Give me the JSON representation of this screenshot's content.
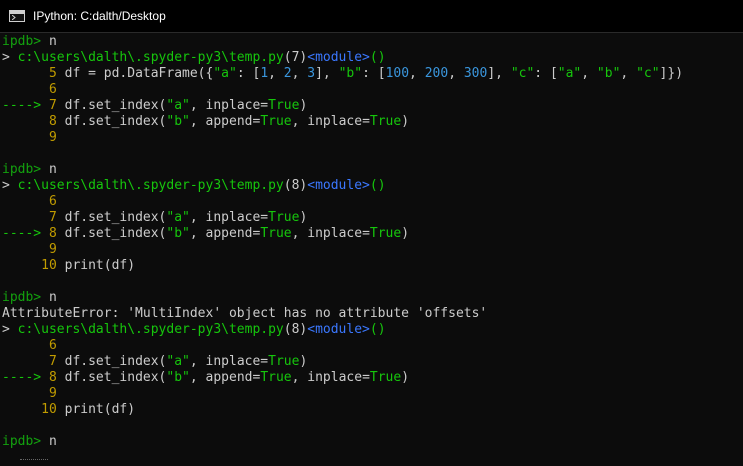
{
  "window": {
    "title": "IPython: C:dalth/Desktop",
    "icon": "console-icon"
  },
  "lines": [
    {
      "segments": [
        {
          "t": "ipdb> ",
          "c": "lp"
        },
        {
          "t": "n",
          "c": "txt"
        }
      ]
    },
    {
      "segments": [
        {
          "t": "> ",
          "c": "txt"
        },
        {
          "t": "c:\\users\\dalth\\.spyder-py3\\temp.py",
          "c": "grn"
        },
        {
          "t": "(7)",
          "c": "txt"
        },
        {
          "t": "<module>",
          "c": "mod"
        },
        {
          "t": "()",
          "c": "grn"
        }
      ]
    },
    {
      "segments": [
        {
          "t": "      ",
          "c": "txt"
        },
        {
          "t": "5",
          "c": "lnum"
        },
        {
          "t": " df = pd.DataFrame({",
          "c": "txt"
        },
        {
          "t": "\"a\"",
          "c": "strc"
        },
        {
          "t": ": [",
          "c": "txt"
        },
        {
          "t": "1",
          "c": "num"
        },
        {
          "t": ", ",
          "c": "txt"
        },
        {
          "t": "2",
          "c": "num"
        },
        {
          "t": ", ",
          "c": "txt"
        },
        {
          "t": "3",
          "c": "num"
        },
        {
          "t": "], ",
          "c": "txt"
        },
        {
          "t": "\"b\"",
          "c": "strc"
        },
        {
          "t": ": [",
          "c": "txt"
        },
        {
          "t": "100",
          "c": "num"
        },
        {
          "t": ", ",
          "c": "txt"
        },
        {
          "t": "200",
          "c": "num"
        },
        {
          "t": ", ",
          "c": "txt"
        },
        {
          "t": "300",
          "c": "num"
        },
        {
          "t": "], ",
          "c": "txt"
        },
        {
          "t": "\"c\"",
          "c": "strc"
        },
        {
          "t": ": [",
          "c": "txt"
        },
        {
          "t": "\"a\"",
          "c": "strc"
        },
        {
          "t": ", ",
          "c": "txt"
        },
        {
          "t": "\"b\"",
          "c": "strc"
        },
        {
          "t": ", ",
          "c": "txt"
        },
        {
          "t": "\"c\"",
          "c": "strc"
        },
        {
          "t": "]})",
          "c": "txt"
        }
      ]
    },
    {
      "segments": [
        {
          "t": "      ",
          "c": "txt"
        },
        {
          "t": "6",
          "c": "lnum"
        }
      ]
    },
    {
      "segments": [
        {
          "t": "----> ",
          "c": "arrow"
        },
        {
          "t": "7",
          "c": "lnum"
        },
        {
          "t": " df.set_index(",
          "c": "txt"
        },
        {
          "t": "\"a\"",
          "c": "strc"
        },
        {
          "t": ", inplace=",
          "c": "txt"
        },
        {
          "t": "True",
          "c": "strc"
        },
        {
          "t": ")",
          "c": "txt"
        }
      ]
    },
    {
      "segments": [
        {
          "t": "      ",
          "c": "txt"
        },
        {
          "t": "8",
          "c": "lnum"
        },
        {
          "t": " df.set_index(",
          "c": "txt"
        },
        {
          "t": "\"b\"",
          "c": "strc"
        },
        {
          "t": ", append=",
          "c": "txt"
        },
        {
          "t": "True",
          "c": "strc"
        },
        {
          "t": ", inplace=",
          "c": "txt"
        },
        {
          "t": "True",
          "c": "strc"
        },
        {
          "t": ")",
          "c": "txt"
        }
      ]
    },
    {
      "segments": [
        {
          "t": "      ",
          "c": "txt"
        },
        {
          "t": "9",
          "c": "lnum"
        }
      ]
    },
    {
      "segments": [
        {
          "t": "",
          "c": "txt"
        }
      ]
    },
    {
      "segments": [
        {
          "t": "ipdb> ",
          "c": "lp"
        },
        {
          "t": "n",
          "c": "txt"
        }
      ]
    },
    {
      "segments": [
        {
          "t": "> ",
          "c": "txt"
        },
        {
          "t": "c:\\users\\dalth\\.spyder-py3\\temp.py",
          "c": "grn"
        },
        {
          "t": "(8)",
          "c": "txt"
        },
        {
          "t": "<module>",
          "c": "mod"
        },
        {
          "t": "()",
          "c": "grn"
        }
      ]
    },
    {
      "segments": [
        {
          "t": "      ",
          "c": "txt"
        },
        {
          "t": "6",
          "c": "lnum"
        }
      ]
    },
    {
      "segments": [
        {
          "t": "      ",
          "c": "txt"
        },
        {
          "t": "7",
          "c": "lnum"
        },
        {
          "t": " df.set_index(",
          "c": "txt"
        },
        {
          "t": "\"a\"",
          "c": "strc"
        },
        {
          "t": ", inplace=",
          "c": "txt"
        },
        {
          "t": "True",
          "c": "strc"
        },
        {
          "t": ")",
          "c": "txt"
        }
      ]
    },
    {
      "segments": [
        {
          "t": "----> ",
          "c": "arrow"
        },
        {
          "t": "8",
          "c": "lnum"
        },
        {
          "t": " df.set_index(",
          "c": "txt"
        },
        {
          "t": "\"b\"",
          "c": "strc"
        },
        {
          "t": ", append=",
          "c": "txt"
        },
        {
          "t": "True",
          "c": "strc"
        },
        {
          "t": ", inplace=",
          "c": "txt"
        },
        {
          "t": "True",
          "c": "strc"
        },
        {
          "t": ")",
          "c": "txt"
        }
      ]
    },
    {
      "segments": [
        {
          "t": "      ",
          "c": "txt"
        },
        {
          "t": "9",
          "c": "lnum"
        }
      ]
    },
    {
      "segments": [
        {
          "t": "     ",
          "c": "txt"
        },
        {
          "t": "10",
          "c": "lnum"
        },
        {
          "t": " print(df)",
          "c": "txt"
        }
      ]
    },
    {
      "segments": [
        {
          "t": "",
          "c": "txt"
        }
      ]
    },
    {
      "segments": [
        {
          "t": "ipdb> ",
          "c": "lp"
        },
        {
          "t": "n",
          "c": "txt"
        }
      ]
    },
    {
      "segments": [
        {
          "t": "AttributeError: 'MultiIndex' object has no attribute 'offsets'",
          "c": "txt"
        }
      ]
    },
    {
      "segments": [
        {
          "t": "> ",
          "c": "txt"
        },
        {
          "t": "c:\\users\\dalth\\.spyder-py3\\temp.py",
          "c": "grn"
        },
        {
          "t": "(8)",
          "c": "txt"
        },
        {
          "t": "<module>",
          "c": "mod"
        },
        {
          "t": "()",
          "c": "grn"
        }
      ]
    },
    {
      "segments": [
        {
          "t": "      ",
          "c": "txt"
        },
        {
          "t": "6",
          "c": "lnum"
        }
      ]
    },
    {
      "segments": [
        {
          "t": "      ",
          "c": "txt"
        },
        {
          "t": "7",
          "c": "lnum"
        },
        {
          "t": " df.set_index(",
          "c": "txt"
        },
        {
          "t": "\"a\"",
          "c": "strc"
        },
        {
          "t": ", inplace=",
          "c": "txt"
        },
        {
          "t": "True",
          "c": "strc"
        },
        {
          "t": ")",
          "c": "txt"
        }
      ]
    },
    {
      "segments": [
        {
          "t": "----> ",
          "c": "arrow"
        },
        {
          "t": "8",
          "c": "lnum"
        },
        {
          "t": " df.set_index(",
          "c": "txt"
        },
        {
          "t": "\"b\"",
          "c": "strc"
        },
        {
          "t": ", append=",
          "c": "txt"
        },
        {
          "t": "True",
          "c": "strc"
        },
        {
          "t": ", inplace=",
          "c": "txt"
        },
        {
          "t": "True",
          "c": "strc"
        },
        {
          "t": ")",
          "c": "txt"
        }
      ]
    },
    {
      "segments": [
        {
          "t": "      ",
          "c": "txt"
        },
        {
          "t": "9",
          "c": "lnum"
        }
      ]
    },
    {
      "segments": [
        {
          "t": "     ",
          "c": "txt"
        },
        {
          "t": "10",
          "c": "lnum"
        },
        {
          "t": " print(df)",
          "c": "txt"
        }
      ]
    },
    {
      "segments": [
        {
          "t": "",
          "c": "txt"
        }
      ]
    },
    {
      "segments": [
        {
          "t": "ipdb> ",
          "c": "lp"
        },
        {
          "t": "n",
          "c": "txt"
        }
      ]
    }
  ]
}
